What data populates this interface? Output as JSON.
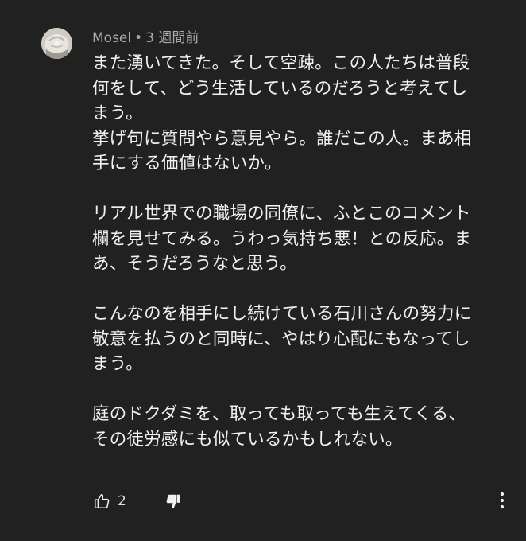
{
  "comment": {
    "author": "Mosel",
    "separator": "•",
    "timestamp": "3 週間前",
    "lines": [
      "また湧いてきた。そして空疎。この人たちは普段",
      "何をして、どう生活しているのだろうと考えてし",
      "まう。",
      "挙げ句に質問やら意見やら。誰だこの人。まあ相",
      "手にする価値はないか。",
      "",
      "リアル世界での職場の同僚に、ふとこのコメント",
      "欄を見せてみる。うわっ気持ち悪！との反応。ま",
      "あ、そうだろうなと思う。",
      "",
      "こんなのを相手にし続けている石川さんの努力に",
      "敬意を払うのと同時に、やはり心配にもなってし",
      "まう。",
      "",
      "庭のドクダミを、取っても取っても生えてくる、",
      "その徒労感にも似ているかもしれない。"
    ],
    "like_count": "2"
  },
  "icons": {
    "like": "thumb-up-outline-icon",
    "dislike": "thumb-down-filled-icon",
    "more": "more-vertical-icon"
  },
  "colors": {
    "background": "#212121",
    "text": "#f1f1f1",
    "meta": "#aaaaaa"
  }
}
